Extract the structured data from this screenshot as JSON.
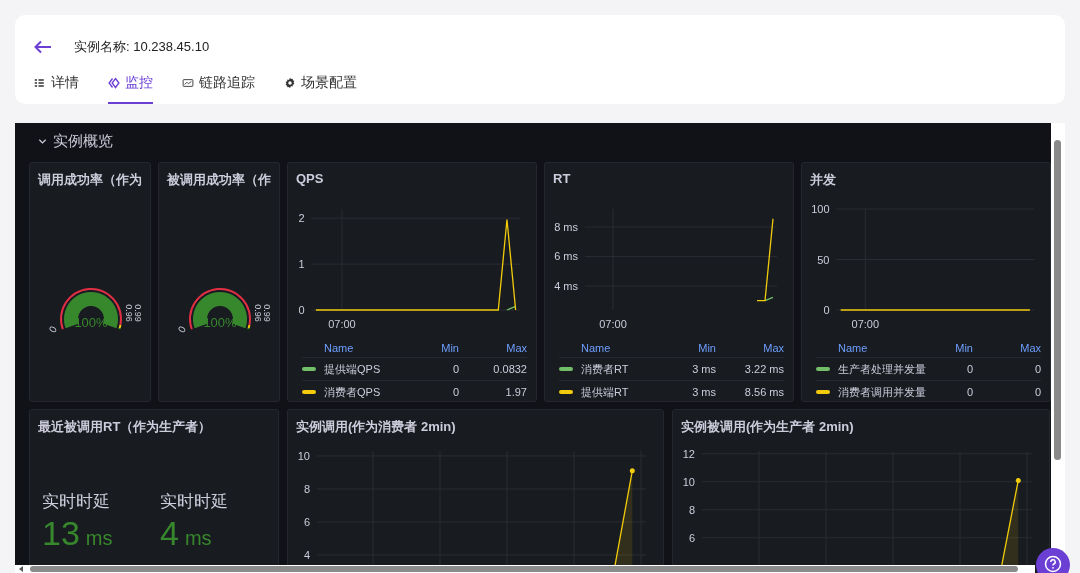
{
  "header": {
    "title": "实例名称: 10.238.45.10"
  },
  "tabs": [
    {
      "label": "详情",
      "selected": false
    },
    {
      "label": "监控",
      "selected": true
    },
    {
      "label": "链路追踪",
      "selected": false
    },
    {
      "label": "场景配置",
      "selected": false
    }
  ],
  "dashboard": {
    "row_title": "实例概览",
    "expanded": true,
    "panel_rows": [
      [
        {
          "kind": "gauge",
          "title": "调用成功率（作为",
          "level": 1,
          "value": "100%",
          "min_label": "0",
          "threshold_labels": [
            "0.96",
            "0.99"
          ]
        },
        {
          "kind": "gauge",
          "title": "被调用成功率（作",
          "level": 1,
          "value": "100%",
          "min_label": "0",
          "threshold_labels": [
            "0.96",
            "0.99"
          ]
        },
        {
          "kind": "timeseries",
          "title": "QPS",
          "chart_data": {
            "type": "line",
            "grid": true,
            "categories": [
              null,
              null,
              null,
              "07:00",
              null,
              null,
              null,
              null,
              null,
              null,
              null,
              null,
              null,
              null,
              null,
              null,
              null,
              null,
              null,
              null,
              null,
              null,
              null,
              null
            ],
            "ylim": [
              0,
              2.2
            ],
            "yticks": [
              {
                "value": 0,
                "label": "0"
              },
              {
                "value": 1,
                "label": "1"
              },
              {
                "value": 2,
                "label": "2"
              }
            ],
            "series": [
              {
                "name": "提供端QPS",
                "color": "#73bf69",
                "values": [
                  null,
                  null,
                  null,
                  null,
                  null,
                  null,
                  null,
                  null,
                  null,
                  null,
                  null,
                  null,
                  null,
                  null,
                  null,
                  null,
                  null,
                  null,
                  null,
                  null,
                  null,
                  null,
                  0,
                  0.08
                ]
              },
              {
                "name": "消费者QPS",
                "color": "#f2cc0c",
                "values": [
                  0,
                  0,
                  0,
                  0,
                  0,
                  0,
                  0,
                  0,
                  0,
                  0,
                  0,
                  0,
                  0,
                  0,
                  0,
                  0,
                  0,
                  0,
                  0,
                  0,
                  0,
                  0,
                  1.97,
                  0
                ]
              }
            ]
          },
          "legend": {
            "columns": [
              "Name",
              "Min",
              "Max"
            ],
            "rows": [
              {
                "min": "0",
                "max": "0.0832"
              },
              {
                "min": "0",
                "max": "1.97"
              }
            ]
          }
        },
        {
          "kind": "timeseries",
          "title": "RT",
          "chart_data": {
            "type": "line",
            "grid": true,
            "categories": [
              null,
              null,
              null,
              "07:00",
              null,
              null,
              null,
              null,
              null,
              null,
              null,
              null,
              null,
              null,
              null,
              null,
              null,
              null,
              null,
              null,
              null,
              null,
              null,
              null
            ],
            "ylim": [
              2.37,
              9.22
            ],
            "yticks": [
              {
                "value": 4,
                "label": "4 ms"
              },
              {
                "value": 6,
                "label": "6 ms"
              },
              {
                "value": 8,
                "label": "8 ms"
              }
            ],
            "series": [
              {
                "name": "消费者RT",
                "color": "#73bf69",
                "values": [
                  null,
                  null,
                  null,
                  null,
                  null,
                  null,
                  null,
                  null,
                  null,
                  null,
                  null,
                  null,
                  null,
                  null,
                  null,
                  null,
                  null,
                  null,
                  null,
                  null,
                  null,
                  null,
                  3,
                  3.22
                ]
              },
              {
                "name": "提供端RT",
                "color": "#f2cc0c",
                "values": [
                  null,
                  null,
                  null,
                  null,
                  null,
                  null,
                  null,
                  null,
                  null,
                  null,
                  null,
                  null,
                  null,
                  null,
                  null,
                  null,
                  null,
                  null,
                  null,
                  null,
                  null,
                  3,
                  3,
                  8.56
                ]
              }
            ]
          },
          "legend": {
            "columns": [
              "Name",
              "Min",
              "Max"
            ],
            "rows": [
              {
                "min": "3 ms",
                "max": "3.22 ms"
              },
              {
                "min": "3 ms",
                "max": "8.56 ms"
              }
            ]
          }
        },
        {
          "kind": "timeseries",
          "title": "并发",
          "chart_data": {
            "type": "line",
            "grid": true,
            "categories": [
              null,
              null,
              null,
              "07:00",
              null,
              null,
              null,
              null,
              null,
              null,
              null,
              null,
              null,
              null,
              null,
              null,
              null,
              null,
              null,
              null,
              null,
              null,
              null,
              null
            ],
            "ylim": [
              0,
              100
            ],
            "yticks": [
              {
                "value": 0,
                "label": "0"
              },
              {
                "value": 50,
                "label": "50"
              },
              {
                "value": 100,
                "label": "100"
              }
            ],
            "series": [
              {
                "name": "生产者处理并发量",
                "color": "#73bf69",
                "values": [
                  null,
                  null,
                  null,
                  null,
                  null,
                  null,
                  null,
                  null,
                  null,
                  null,
                  null,
                  null,
                  null,
                  null,
                  null,
                  null,
                  null,
                  null,
                  null,
                  null,
                  null,
                  null,
                  null,
                  null
                ]
              },
              {
                "name": "消费者调用并发量",
                "color": "#f2cc0c",
                "values": [
                  0,
                  0,
                  0,
                  0,
                  0,
                  0,
                  0,
                  0,
                  0,
                  0,
                  0,
                  0,
                  0,
                  0,
                  0,
                  0,
                  0,
                  0,
                  0,
                  0,
                  0,
                  0,
                  0,
                  0
                ]
              }
            ]
          },
          "legend": {
            "columns": [
              "Name",
              "Min",
              "Max"
            ],
            "rows": [
              {
                "min": "0",
                "max": "0"
              },
              {
                "min": "0",
                "max": "0"
              }
            ]
          }
        }
      ],
      [
        {
          "kind": "stat",
          "title": "最近被调用RT（作为生产者）",
          "stats": [
            {
              "label": "实时时延",
              "value": "13",
              "unit": "ms"
            },
            {
              "label": "实时时延",
              "value": "4",
              "unit": "ms"
            }
          ]
        },
        {
          "kind": "timeseries",
          "title": "实例调用(作为消费者 2min)",
          "chart_data": {
            "type": "area",
            "grid": true,
            "categories": [
              null,
              null,
              null,
              null,
              null,
              null,
              null,
              null,
              null,
              null,
              null,
              null
            ],
            "ylim": [
              0,
              10.3
            ],
            "yticks": [
              {
                "value": 4,
                "label": "4"
              },
              {
                "value": 6,
                "label": "6"
              },
              {
                "value": 8,
                "label": "8"
              },
              {
                "value": 10,
                "label": "10"
              }
            ],
            "series": [
              {
                "color": "#f2cc0c",
                "values": [
                  0,
                  0,
                  0,
                  0,
                  0,
                  0,
                  0,
                  0,
                  0,
                  0,
                  0,
                  9.1
                ]
              }
            ]
          }
        },
        {
          "kind": "timeseries",
          "title": "实例被调用(作为生产者 2min)",
          "chart_data": {
            "type": "area",
            "grid": true,
            "categories": [
              null,
              null,
              null,
              null,
              null,
              null,
              null,
              null,
              null,
              null,
              null,
              null
            ],
            "ylim": [
              0,
              12.2
            ],
            "yticks": [
              {
                "value": 6,
                "label": "6"
              },
              {
                "value": 8,
                "label": "8"
              },
              {
                "value": 10,
                "label": "10"
              },
              {
                "value": 12,
                "label": "12"
              }
            ],
            "series": [
              {
                "color": "#f2cc0c",
                "values": [
                  0,
                  0,
                  0,
                  0,
                  0,
                  0,
                  0,
                  0,
                  0,
                  0,
                  0,
                  10.1
                ]
              }
            ]
          }
        }
      ]
    ]
  }
}
